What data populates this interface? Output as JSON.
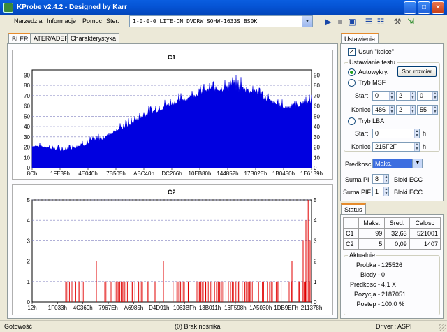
{
  "window": {
    "title": "KProbe v2.4.2 - Designed by Karr"
  },
  "menu": [
    "Narzędzia",
    "Informacje",
    "Pomoc",
    "Ster."
  ],
  "drive": {
    "selected": "1-0-0-0 LITE-ON DVDRW SOHW-1633S BS0K"
  },
  "toolbar_icons": [
    "play-icon",
    "stop-icon",
    "save-icon",
    "layout-icon",
    "layout-alt-icon",
    "tools-icon",
    "exit-icon"
  ],
  "tabs": [
    "BLER",
    "ATER/ADER",
    "Charakterystyka"
  ],
  "chart_data": [
    {
      "type": "area",
      "title": "C1",
      "color": "#0000e0",
      "ylim": [
        0,
        95
      ],
      "y_ticks": [
        0,
        10,
        20,
        30,
        40,
        50,
        60,
        70,
        80,
        90
      ],
      "x_tick_labels": [
        "8Ch",
        "1FE39h",
        "4E040h",
        "7B505h",
        "ABC40h",
        "DC266h",
        "10EB80h",
        "144852h",
        "17B02Eh",
        "1B0450h",
        "1E6139h"
      ],
      "x_fraction": [
        0,
        0.05,
        0.1,
        0.15,
        0.2,
        0.25,
        0.3,
        0.35,
        0.4,
        0.45,
        0.5,
        0.55,
        0.6,
        0.65,
        0.7,
        0.75,
        0.8,
        0.85,
        0.9,
        0.95,
        1
      ],
      "values": [
        20,
        19,
        15,
        18,
        22,
        26,
        34,
        40,
        48,
        54,
        60,
        64,
        70,
        73,
        74,
        72,
        70,
        62,
        56,
        58,
        62
      ],
      "peak_values": [
        25,
        24,
        22,
        25,
        30,
        35,
        42,
        49,
        58,
        64,
        70,
        75,
        80,
        86,
        88,
        92,
        82,
        74,
        66,
        68,
        72
      ]
    },
    {
      "type": "bar",
      "title": "C2",
      "color": "#e00000",
      "ylim": [
        0,
        5
      ],
      "y_ticks": [
        0,
        1,
        2,
        3,
        4,
        5
      ],
      "x_tick_labels": [
        "12h",
        "1F033h",
        "4C369h",
        "7967Eh",
        "A6985h",
        "D4D91h",
        "1063BFh",
        "13B011h",
        "16F598h",
        "1A5030h",
        "1DB9EFh",
        "211378h"
      ],
      "spikes": [
        {
          "x": 0.23,
          "y": 2
        },
        {
          "x": 0.44,
          "y": 1
        },
        {
          "x": 0.47,
          "y": 2
        },
        {
          "x": 0.56,
          "y": 1
        },
        {
          "x": 0.62,
          "y": 1
        },
        {
          "x": 0.66,
          "y": 1
        },
        {
          "x": 0.71,
          "y": 1
        },
        {
          "x": 0.78,
          "y": 1
        },
        {
          "x": 0.85,
          "y": 1
        },
        {
          "x": 0.93,
          "y": 2
        },
        {
          "x": 0.955,
          "y": 1
        },
        {
          "x": 0.97,
          "y": 3
        },
        {
          "x": 0.98,
          "y": 4
        },
        {
          "x": 0.988,
          "y": 5
        },
        {
          "x": 0.995,
          "y": 3
        }
      ],
      "band_ranges": [
        [
          0.12,
          0.2
        ],
        [
          0.26,
          0.42
        ],
        [
          0.5,
          0.56
        ],
        [
          0.59,
          0.9
        ],
        [
          0.92,
          1.0
        ]
      ]
    }
  ],
  "settings": {
    "tab": "Ustawienia",
    "remove_spikes_label": "Usuń \"kolce\"",
    "remove_spikes_checked": true,
    "test_group_label": "Ustawianie testu",
    "auto_label": "Autowykry.",
    "check_size_button": "Spr. rozmiar",
    "msf_label": "Tryb MSF",
    "start_label": "Start",
    "end_label": "Koniec",
    "msf_start": [
      "0",
      "2",
      "0"
    ],
    "msf_end": [
      "486",
      "2",
      "55"
    ],
    "lba_label": "Tryb LBA",
    "lba_start": "0",
    "lba_end": "215F2F",
    "unit_h": "h",
    "speed_label": "Predkosc",
    "speed_value": "Maks.",
    "sum_pi_label": "Suma PI",
    "sum_pi_value": "8",
    "sum_pif_label": "Suma PIF",
    "sum_pif_value": "1",
    "ecc_label": "Bloki ECC"
  },
  "status": {
    "tab": "Status",
    "headers": [
      "Maks.",
      "Sred.",
      "Calosc"
    ],
    "rows": [
      {
        "name": "C1",
        "max": "99",
        "avg": "32,63",
        "total": "521001"
      },
      {
        "name": "C2",
        "max": "5",
        "avg": "0,09",
        "total": "1407"
      }
    ],
    "current_label": "Aktualnie",
    "probe_label": "Probka -",
    "probe_value": "125526",
    "errors_label": "Bledy -",
    "errors_value": "0",
    "speed_label": "Predkosc -",
    "speed_value": "4,1 X",
    "position_label": "Pozycja -",
    "position_value": "2187051",
    "progress_label": "Postep -",
    "progress_value": "100,0 %"
  },
  "statusbar": {
    "left": "Gotowość",
    "center": "(0) Brak nośnika",
    "right": "Driver : ASPI"
  }
}
